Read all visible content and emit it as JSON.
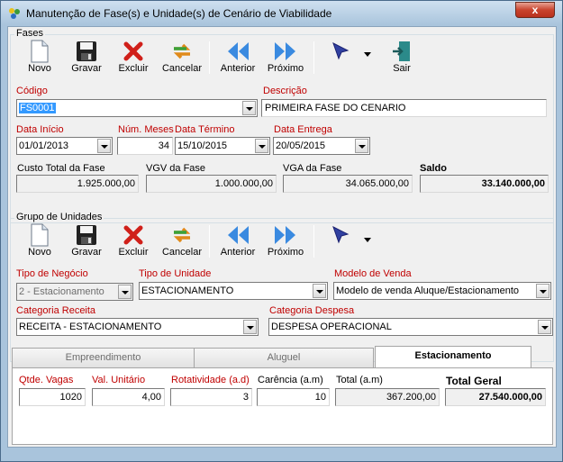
{
  "window": {
    "title": "Manutenção de Fase(s) e Unidade(s) de Cenário de Viabilidade",
    "close_label": "x"
  },
  "fases": {
    "group_label": "Fases",
    "toolbar": {
      "novo": "Novo",
      "gravar": "Gravar",
      "excluir": "Excluir",
      "cancelar": "Cancelar",
      "anterior": "Anterior",
      "proximo": "Próximo",
      "sair": "Sair"
    },
    "codigo_label": "Código",
    "codigo_value": "FS0001",
    "descricao_label": "Descrição",
    "descricao_value": "PRIMEIRA FASE DO CENARIO",
    "data_inicio_label": "Data Início",
    "data_inicio_value": "01/01/2013",
    "num_meses_label": "Núm. Meses",
    "num_meses_value": "34",
    "data_termino_label": "Data Término",
    "data_termino_value": "15/10/2015",
    "data_entrega_label": "Data Entrega",
    "data_entrega_value": "20/05/2015",
    "custo_total_label": "Custo Total da Fase",
    "custo_total_value": "1.925.000,00",
    "vgv_label": "VGV da Fase",
    "vgv_value": "1.000.000,00",
    "vga_label": "VGA da Fase",
    "vga_value": "34.065.000,00",
    "saldo_label": "Saldo",
    "saldo_value": "33.140.000,00"
  },
  "grupo": {
    "group_label": "Grupo de Unidades",
    "toolbar": {
      "novo": "Novo",
      "gravar": "Gravar",
      "excluir": "Excluir",
      "cancelar": "Cancelar",
      "anterior": "Anterior",
      "proximo": "Próximo"
    },
    "tipo_negocio_label": "Tipo de Negócio",
    "tipo_negocio_value": "2 - Estacionamento",
    "tipo_unidade_label": "Tipo de Unidade",
    "tipo_unidade_value": "ESTACIONAMENTO",
    "modelo_venda_label": "Modelo de Venda",
    "modelo_venda_value": "Modelo de venda Aluque/Estacionamento",
    "categoria_receita_label": "Categoria Receita",
    "categoria_receita_value": "RECEITA - ESTACIONAMENTO",
    "categoria_despesa_label": "Categoria Despesa",
    "categoria_despesa_value": "DESPESA OPERACIONAL"
  },
  "tabs": [
    {
      "label": "Empreendimento"
    },
    {
      "label": "Aluguel"
    },
    {
      "label": "Estacionamento"
    }
  ],
  "estacionamento": {
    "qtde_vagas_label": "Qtde. Vagas",
    "qtde_vagas_value": "1020",
    "val_unitario_label": "Val. Unitário",
    "val_unitario_value": "4,00",
    "rotatividade_label": "Rotatividade (a.d)",
    "rotatividade_value": "3",
    "carencia_label": "Carência (a.m)",
    "carencia_value": "10",
    "total_label": "Total (a.m)",
    "total_value": "367.200,00",
    "total_geral_label": "Total Geral",
    "total_geral_value": "27.540.000,00"
  },
  "colors": {
    "label_red": "#c00000",
    "selection": "#3399ff",
    "window_frame": "#a9c4dc"
  }
}
